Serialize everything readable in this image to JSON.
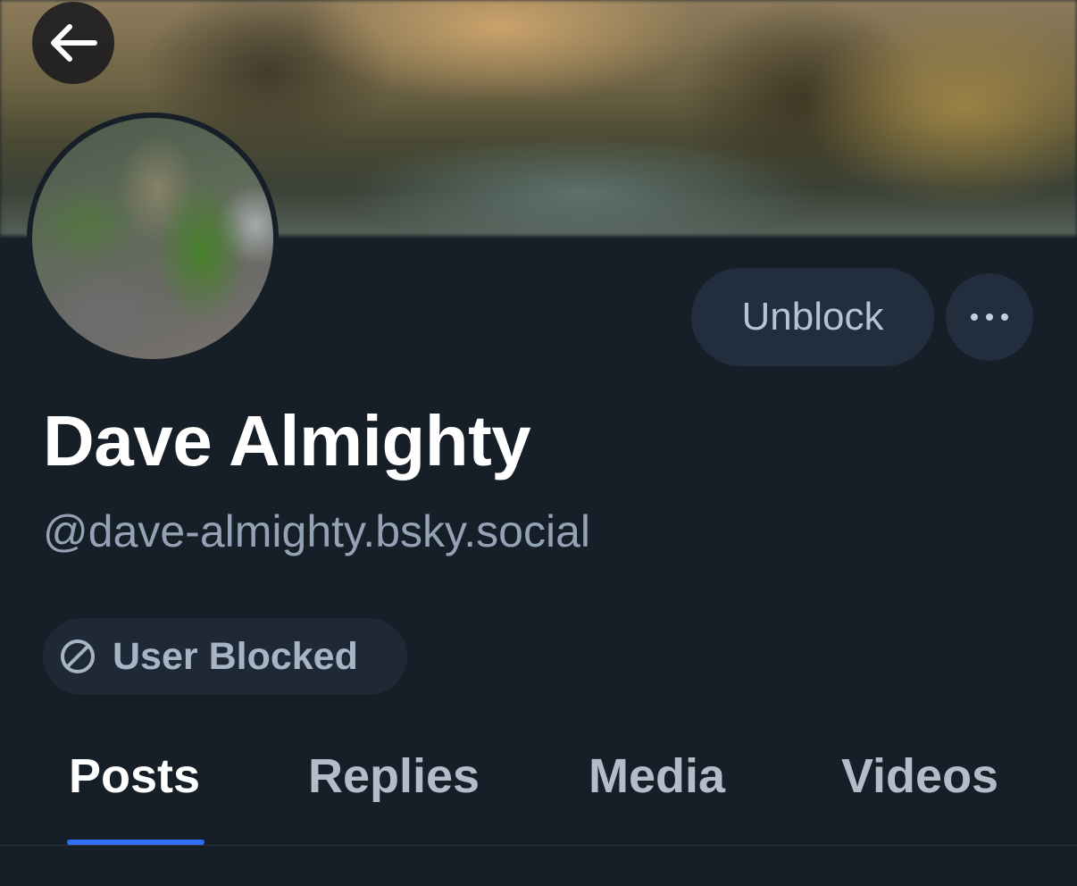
{
  "profile": {
    "display_name": "Dave Almighty",
    "handle": "@dave-almighty.bsky.social"
  },
  "actions": {
    "unblock_label": "Unblock",
    "more_icon": "ellipsis-icon",
    "back_icon": "arrow-left-icon"
  },
  "status_badge": {
    "label": "User Blocked",
    "icon": "block-icon"
  },
  "tabs": [
    {
      "label": "Posts",
      "active": true
    },
    {
      "label": "Replies",
      "active": false
    },
    {
      "label": "Media",
      "active": false
    },
    {
      "label": "Videos",
      "active": false
    }
  ],
  "colors": {
    "background": "#161e27",
    "accent": "#2f6ef5",
    "button_bg": "#222d3d"
  }
}
